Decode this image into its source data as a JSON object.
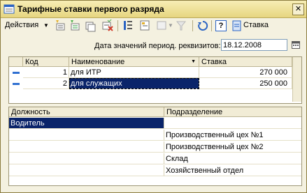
{
  "window": {
    "title": "Тарифные ставки первого разряда"
  },
  "toolbar": {
    "actions_label": "Действия",
    "stavka_label": "Ставка",
    "help_label": "?"
  },
  "period": {
    "label": "Дата значений период. реквизитов:",
    "date": "18.12.2008"
  },
  "rates_table": {
    "headers": {
      "code": "Код",
      "name": "Наименование",
      "rate": "Ставка"
    },
    "rows": [
      {
        "code": "1",
        "name": "для ИТР",
        "rate": "270 000"
      },
      {
        "code": "2",
        "name": "для служащих",
        "rate": "250 000"
      }
    ]
  },
  "positions_table": {
    "headers": {
      "position": "Должность",
      "department": "Подразделение"
    },
    "rows": [
      {
        "position": "Водитель",
        "department": ""
      },
      {
        "position": "",
        "department": "Производственный цех №1"
      },
      {
        "position": "",
        "department": "Производственный цех №2"
      },
      {
        "position": "",
        "department": "Склад"
      },
      {
        "position": "",
        "department": "Хозяйственный отдел"
      }
    ]
  },
  "colors": {
    "selection": "#0a246a",
    "title_bg": "#efe2a0"
  }
}
